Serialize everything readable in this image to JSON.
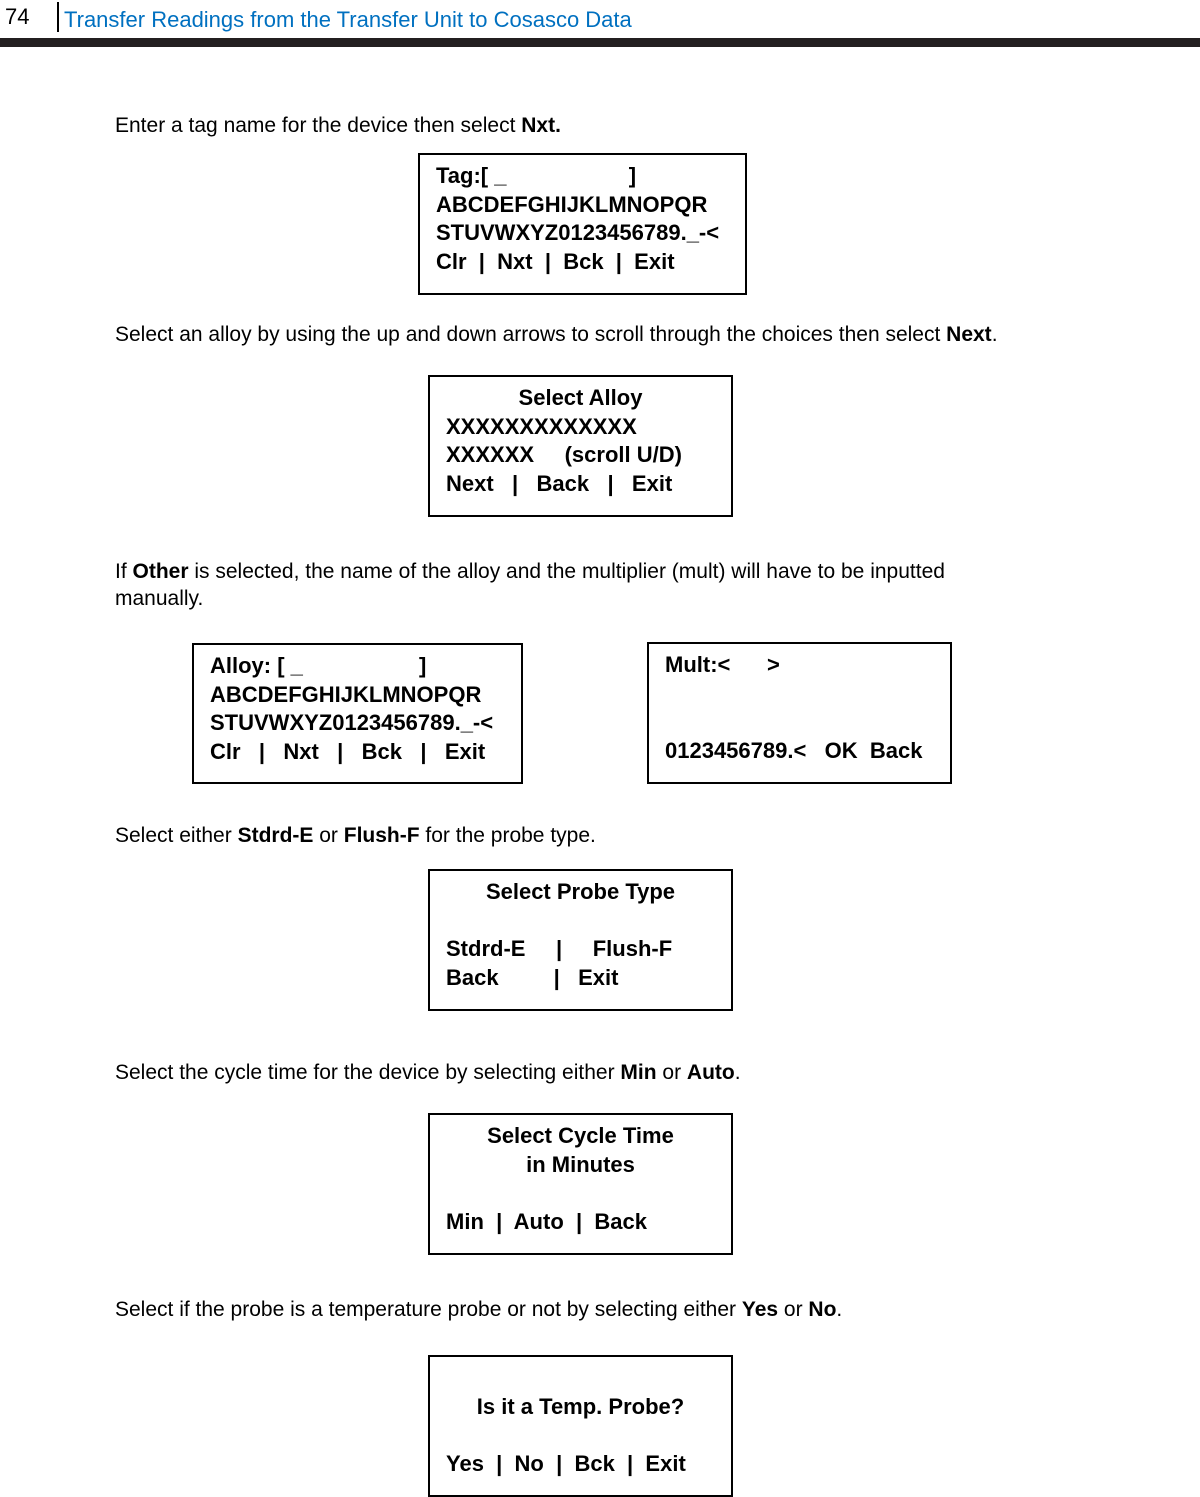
{
  "header": {
    "page_number": "74",
    "title": "Transfer Readings from the Transfer Unit to Cosasco Data"
  },
  "paragraphs": [
    [
      {
        "t": "Enter a tag name for the device then select "
      },
      {
        "t": "Nxt.",
        "b": true
      }
    ],
    [
      {
        "t": "Select an alloy by using the up and down arrows to scroll through the choices then select "
      },
      {
        "t": "Next",
        "b": true
      },
      {
        "t": "."
      }
    ],
    [
      {
        "t": "If "
      },
      {
        "t": "Other",
        "b": true
      },
      {
        "t": " is selected, the name of the alloy and the multiplier (mult) will have to be inputted manually."
      }
    ],
    [
      {
        "t": "Select either "
      },
      {
        "t": "Stdrd-E",
        "b": true
      },
      {
        "t": " or "
      },
      {
        "t": "Flush-F",
        "b": true
      },
      {
        "t": " for the probe type."
      }
    ],
    [
      {
        "t": "Select the cycle time for the device by selecting either "
      },
      {
        "t": "Min",
        "b": true
      },
      {
        "t": " or "
      },
      {
        "t": "Auto",
        "b": true
      },
      {
        "t": "."
      }
    ],
    [
      {
        "t": "Select if the probe is a temperature probe or not by selecting either "
      },
      {
        "t": "Yes",
        "b": true
      },
      {
        "t": " or "
      },
      {
        "t": "No",
        "b": true
      },
      {
        "t": "."
      }
    ]
  ],
  "screens": {
    "tag": [
      "Tag:[ _                    ]",
      "ABCDEFGHIJKLMNOPQR",
      "STUVWXYZ0123456789._-<",
      "Clr  |  Nxt  |  Bck  |  Exit"
    ],
    "alloy_select": [
      "Select Alloy",
      "XXXXXXXXXXXXX",
      "XXXXXX     (scroll U/D)",
      "Next   |   Back   |   Exit"
    ],
    "alloy_name": [
      "Alloy: [ _                   ]",
      "ABCDEFGHIJKLMNOPQR",
      "STUVWXYZ0123456789._-<",
      "Clr   |   Nxt   |   Bck   |   Exit"
    ],
    "mult": [
      "Mult:<      >",
      "",
      "",
      "0123456789.<   OK  Back"
    ],
    "probe_type": [
      "Select Probe Type",
      "",
      "Stdrd-E     |     Flush-F",
      "Back         |   Exit"
    ],
    "cycle_time": [
      "Select Cycle Time",
      "in Minutes",
      "",
      "Min  |  Auto  |  Back"
    ],
    "temp_probe": [
      "",
      "Is it a Temp. Probe?",
      "",
      "Yes  |  No  |  Bck  |  Exit"
    ]
  }
}
